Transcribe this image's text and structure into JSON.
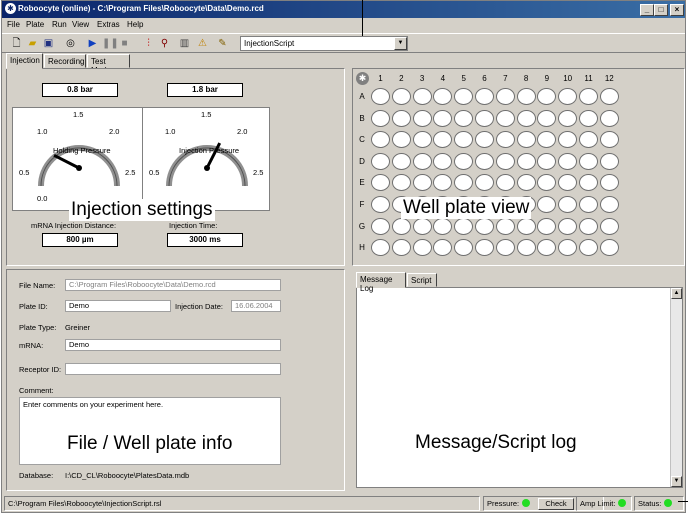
{
  "window": {
    "title": "Roboocyte (online) - C:\\Program Files\\Roboocyte\\Data\\Demo.rcd",
    "minimize": "_",
    "maximize": "□",
    "close": "×"
  },
  "menu": [
    "File",
    "Plate",
    "Run",
    "View",
    "Extras",
    "Help"
  ],
  "toolbar": {
    "icons": [
      "new-file-icon",
      "open-folder-icon",
      "save-icon",
      "target-icon",
      "play-icon",
      "pause-icon",
      "stop-icon",
      "chart-icon",
      "chart-magnify-icon",
      "plate-icon",
      "warning-icon",
      "script-icon"
    ],
    "script_select": "InjectionScript",
    "dropdown_arrow": "▼"
  },
  "tabs": [
    "Injection",
    "Recording",
    "Test Mode"
  ],
  "injection": {
    "holding_pressure": "0.8 bar",
    "injection_pressure": "1.8 bar",
    "gauge1_label": "Holding Pressure",
    "gauge2_label": "Injection Pressure",
    "gauge_ticks": [
      "0.0",
      "0.5",
      "1.0",
      "1.5",
      "2.0",
      "2.5"
    ],
    "holding_value": 0.8,
    "injection_value": 1.8,
    "distance_label": "mRNA Injection Distance:",
    "distance_value": "800  µm",
    "time_label": "Injection Time:",
    "time_value": "3000 ms"
  },
  "plate": {
    "columns": [
      "1",
      "2",
      "3",
      "4",
      "5",
      "6",
      "7",
      "8",
      "9",
      "10",
      "11",
      "12"
    ],
    "rows": [
      "A",
      "B",
      "C",
      "D",
      "E",
      "F",
      "G",
      "H"
    ]
  },
  "info": {
    "file_name_label": "File Name:",
    "file_name": "C:\\Program Files\\Roboocyte\\Data\\Demo.rcd",
    "plate_id_label": "Plate ID:",
    "plate_id": "Demo",
    "injection_date_label": "Injection Date:",
    "injection_date": "16.06.2004",
    "plate_type_label": "Plate Type:",
    "plate_type": "Greiner",
    "mrna_label": "mRNA:",
    "mrna": "Demo",
    "receptor_label": "Receptor ID:",
    "receptor": "",
    "comment_label": "Comment:",
    "comment": "Enter comments on your experiment here.",
    "database_label": "Database:",
    "database": "I:\\CD_CL\\Roboocyte\\PlatesData.mdb"
  },
  "log_tabs": [
    "Message Log",
    "Script"
  ],
  "annotations": {
    "injection": "Injection settings",
    "well": "Well plate view",
    "file": "File / Well plate info",
    "message": "Message/Script log"
  },
  "status": {
    "path": "C:\\Program Files\\Roboocyte\\InjectionScript.rsl",
    "pressure_label": "Pressure:",
    "check_label": "Check",
    "amp_label": "Amp Limit:",
    "status_label": "Status:",
    "led_color": "#22dd22"
  }
}
